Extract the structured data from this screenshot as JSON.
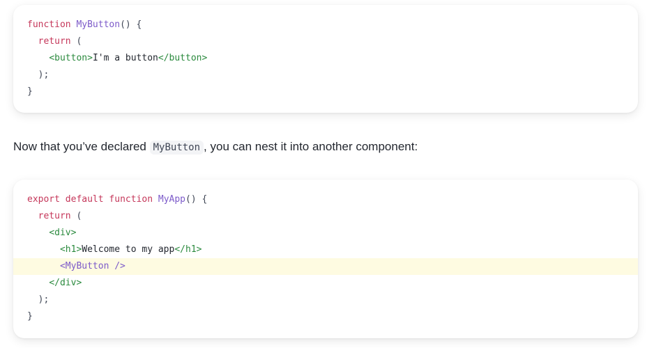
{
  "code_block_1": {
    "lines": [
      [
        [
          "kw",
          "function"
        ],
        [
          "plain",
          " "
        ],
        [
          "fn",
          "MyButton"
        ],
        [
          "punc",
          "() {"
        ]
      ],
      [
        [
          "plain",
          "  "
        ],
        [
          "kw",
          "return"
        ],
        [
          "punc",
          " ("
        ]
      ],
      [
        [
          "plain",
          "    "
        ],
        [
          "tag",
          "<button>"
        ],
        [
          "plain",
          "I'm a button"
        ],
        [
          "tag",
          "</button>"
        ]
      ],
      [
        [
          "punc",
          "  );"
        ]
      ],
      [
        [
          "punc",
          "}"
        ]
      ]
    ],
    "highlight_line": -1
  },
  "prose": {
    "before": "Now that you’ve declared ",
    "code": "MyButton",
    "after": ", you can nest it into another component:"
  },
  "code_block_2": {
    "lines": [
      [
        [
          "kw",
          "export"
        ],
        [
          "plain",
          " "
        ],
        [
          "kw",
          "default"
        ],
        [
          "plain",
          " "
        ],
        [
          "kw",
          "function"
        ],
        [
          "plain",
          " "
        ],
        [
          "fn",
          "MyApp"
        ],
        [
          "punc",
          "() {"
        ]
      ],
      [
        [
          "plain",
          "  "
        ],
        [
          "kw",
          "return"
        ],
        [
          "punc",
          " ("
        ]
      ],
      [
        [
          "plain",
          "    "
        ],
        [
          "tag",
          "<div>"
        ]
      ],
      [
        [
          "plain",
          "      "
        ],
        [
          "tag",
          "<h1>"
        ],
        [
          "plain",
          "Welcome to my app"
        ],
        [
          "tag",
          "</h1>"
        ]
      ],
      [
        [
          "plain",
          "      "
        ],
        [
          "fn",
          "<MyButton />"
        ]
      ],
      [
        [
          "plain",
          "    "
        ],
        [
          "tag",
          "</div>"
        ]
      ],
      [
        [
          "punc",
          "  );"
        ]
      ],
      [
        [
          "punc",
          "}"
        ]
      ]
    ],
    "highlight_line": 4
  },
  "colors": {
    "keyword": "#c5375a",
    "function_name": "#7c5ac9",
    "tag": "#2b8a3e",
    "highlight_background": "#fefbe1",
    "text": "#23272f"
  }
}
